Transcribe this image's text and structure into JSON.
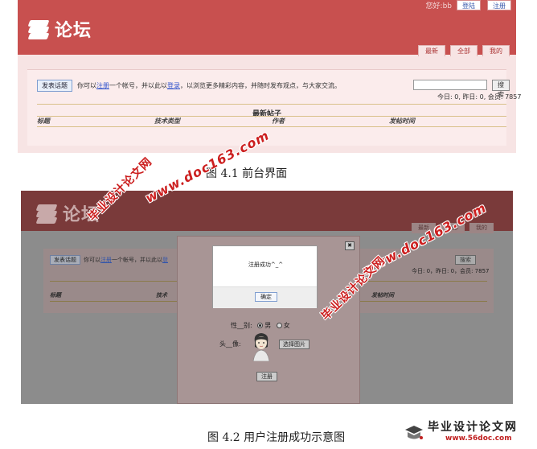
{
  "figure1": {
    "app_title": "论坛",
    "welcome": "您好:bb",
    "login_label": "登陆",
    "register_label": "注册",
    "tabs": [
      "最新",
      "全部",
      "我的"
    ],
    "post_button": "发表话题",
    "intro": {
      "part1": "你可以",
      "link1": "注册",
      "part2": "一个帐号，并以此以",
      "link2": "登录",
      "part3": "，以浏览更多精彩内容，并随时发布观点，与大家交流。"
    },
    "search_button": "搜索",
    "stats": "今日: 0, 昨日: 0, 会员: 7857",
    "section_title": "最新帖子",
    "columns": [
      "标题",
      "技术类型",
      "作者",
      "发帖时间"
    ]
  },
  "caption1": "图 4.1 前台界面",
  "figure2": {
    "app_title": "论坛",
    "tabs": [
      "最新",
      "全部",
      "我的"
    ],
    "post_button": "发表话题",
    "intro": {
      "part1": "你可以",
      "link1": "注册",
      "part2": "一个帐号，并以此以",
      "link2": "登"
    },
    "search_button": "搜索",
    "stats": "今日: 0，昨日: 0，会员: 7857",
    "columns": [
      "标题",
      "技术",
      "发帖时间"
    ],
    "dialog": {
      "close": "✖",
      "gender_label": "性__别:",
      "male": "男",
      "female": "女",
      "avatar_label": "头__像:",
      "choose_image": "选择图片",
      "register_button": "注册"
    },
    "success": {
      "message": "注册成功^_^",
      "ok_button": "确定"
    }
  },
  "caption2": "图 4.2 用户注册成功示意图",
  "watermarks": {
    "site": "www.doc163.com",
    "cn": "毕业设计论文网"
  },
  "corner_logo": {
    "title": "毕业设计论文网",
    "url": "www.56doc.com"
  }
}
